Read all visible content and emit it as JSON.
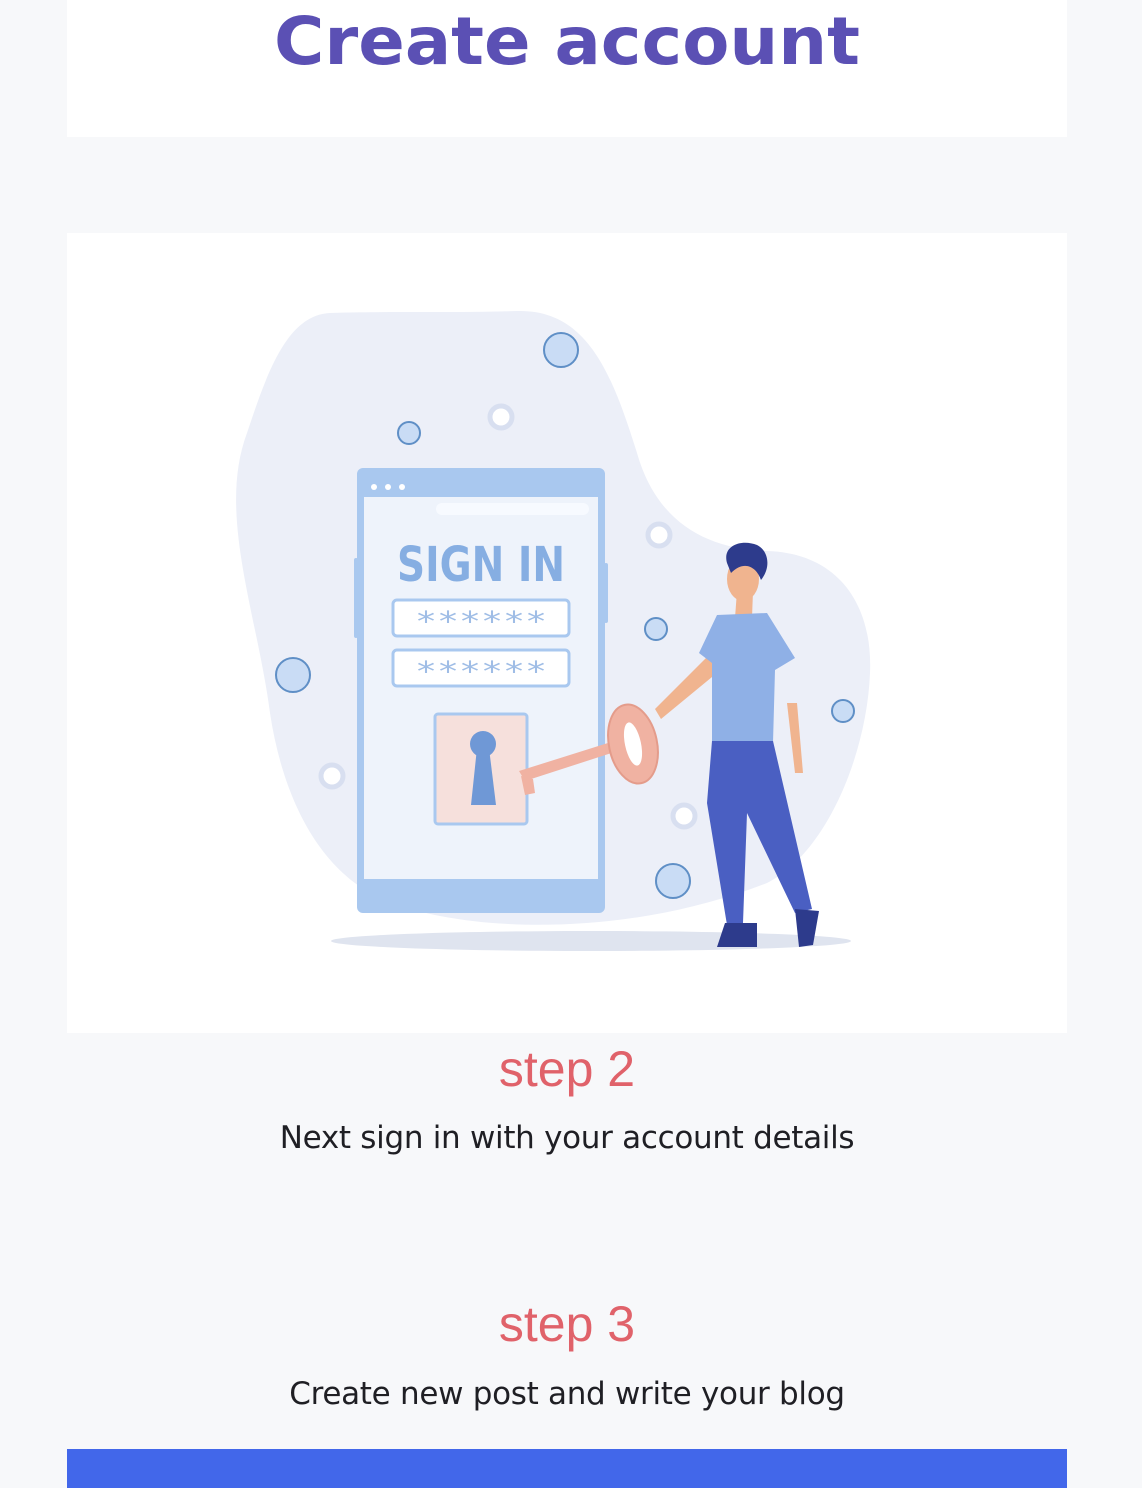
{
  "header": {
    "title": "Create account"
  },
  "illustration": {
    "signin_label": "SIGN IN",
    "password_mask_1": "******",
    "password_mask_2": "******"
  },
  "steps": [
    {
      "title": "step 2",
      "description": "Next sign in with your account details"
    },
    {
      "title": "step 3",
      "description": "Create new post and write your blog"
    }
  ],
  "colors": {
    "heading": "#5b50b4",
    "step_title": "#e0626a",
    "footer": "#4267ea",
    "page_bg": "#f7f8fa"
  }
}
